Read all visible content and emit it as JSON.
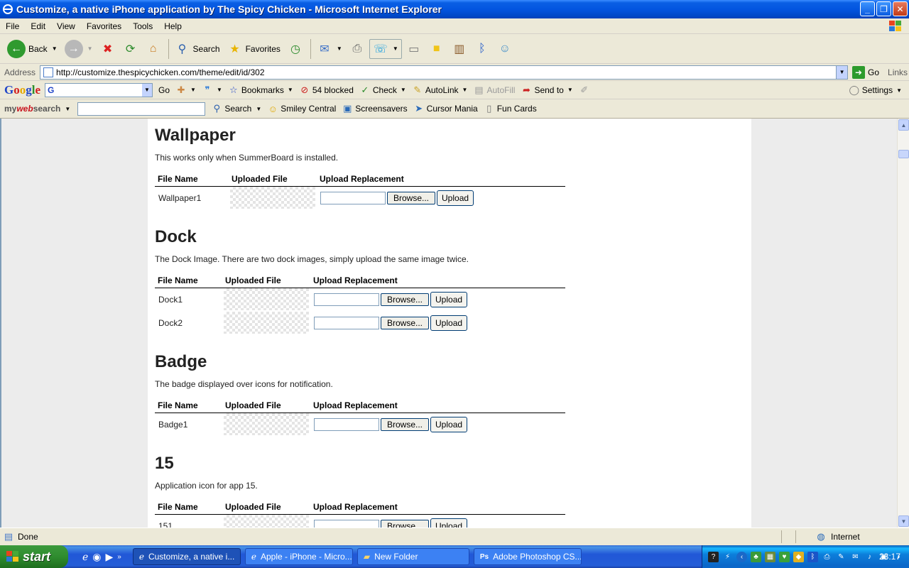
{
  "window": {
    "title": "Customize, a native iPhone application by The Spicy Chicken - Microsoft Internet Explorer",
    "controls": [
      "minimize",
      "maximize",
      "close"
    ]
  },
  "menubar": [
    "File",
    "Edit",
    "View",
    "Favorites",
    "Tools",
    "Help"
  ],
  "toolbar": {
    "back_label": "Back",
    "search_label": "Search",
    "favorites_label": "Favorites"
  },
  "address": {
    "label": "Address",
    "url": "http://customize.thespicychicken.com/theme/edit/id/302",
    "go_label": "Go",
    "links_label": "Links"
  },
  "googlebar": {
    "logo": "Google",
    "go_label": "Go",
    "bookmarks_label": "Bookmarks",
    "blocked_label": "54 blocked",
    "check_label": "Check",
    "autolink_label": "AutoLink",
    "autofill_label": "AutoFill",
    "sendto_label": "Send to",
    "settings_label": "Settings"
  },
  "mwsbar": {
    "logo_my": "my",
    "logo_web": "web",
    "logo_search": "search",
    "search_label": "Search",
    "items": [
      "Smiley Central",
      "Screensavers",
      "Cursor Mania",
      "Fun Cards"
    ]
  },
  "page": {
    "table_headers": {
      "file_name": "File Name",
      "uploaded_file": "Uploaded File",
      "upload_replacement": "Upload Replacement"
    },
    "browse_label": "Browse...",
    "upload_label": "Upload",
    "sections": [
      {
        "title": "Wallpaper",
        "description": "This works only when SummerBoard is installed.",
        "files": [
          "Wallpaper1"
        ]
      },
      {
        "title": "Dock",
        "description": "The Dock Image. There are two dock images, simply upload the same image twice.",
        "files": [
          "Dock1",
          "Dock2"
        ]
      },
      {
        "title": "Badge",
        "description": "The badge displayed over icons for notification.",
        "files": [
          "Badge1"
        ]
      },
      {
        "title": "15",
        "description": "Application icon for app 15.",
        "files": [
          "151"
        ]
      }
    ]
  },
  "statusbar": {
    "status": "Done",
    "zone": "Internet"
  },
  "taskbar": {
    "start_label": "start",
    "tasks": [
      {
        "label": "Customize, a native i...",
        "active": true
      },
      {
        "label": "Apple - iPhone - Micro...",
        "active": false
      },
      {
        "label": "New Folder",
        "active": false
      },
      {
        "label": "Adobe Photoshop CS...",
        "active": false
      }
    ],
    "clock": "23:17"
  }
}
